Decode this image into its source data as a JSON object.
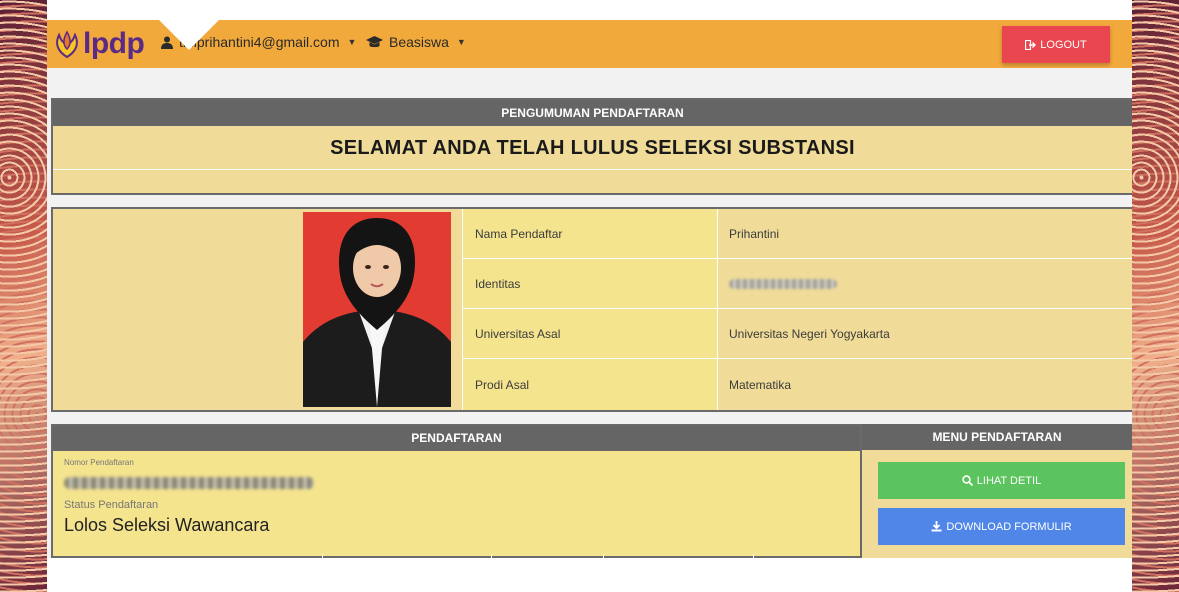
{
  "navbar": {
    "logo_text": "lpdp",
    "user_email": "tiniprihantini4@gmail.com",
    "beasiswa_label": "Beasiswa",
    "logout_label": "LOGOUT"
  },
  "announcement": {
    "header": "PENGUMUMAN PENDAFTARAN",
    "title": "SELAMAT ANDA TELAH LULUS SELEKSI SUBSTANSI"
  },
  "profile": {
    "rows": [
      {
        "label": "Nama Pendaftar",
        "value": "Prihantini"
      },
      {
        "label": "Identitas",
        "value": ""
      },
      {
        "label": "Universitas Asal",
        "value": "Universitas Negeri Yogyakarta"
      },
      {
        "label": "Prodi Asal",
        "value": "Matematika"
      }
    ]
  },
  "registration": {
    "header": "PENDAFTARAN",
    "number_label": "Nomor Pendaftaran",
    "status_label": "Status Pendaftaran",
    "status_value": "Lolos Seleksi Wawancara"
  },
  "menu": {
    "header": "MENU PENDAFTARAN",
    "detail_label": "LIHAT DETIL",
    "download_label": "DOWNLOAD FORMULIR"
  },
  "colors": {
    "navbar": "#f2a93b",
    "logout": "#e9464f",
    "detail": "#5bc45f",
    "download": "#4f86e8",
    "panel_head": "#656565",
    "panel_body": "#f0dc98"
  }
}
